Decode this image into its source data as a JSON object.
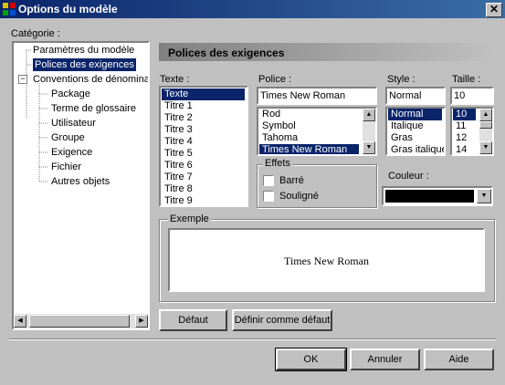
{
  "window": {
    "title": "Options du modèle",
    "close_symbol": "✕"
  },
  "category": {
    "label": "Catégorie :",
    "tree": [
      {
        "label": "Paramètres du modèle"
      },
      {
        "label": "Polices des exigences"
      },
      {
        "label": "Conventions de dénomination"
      },
      {
        "label": "Package"
      },
      {
        "label": "Terme de glossaire"
      },
      {
        "label": "Utilisateur"
      },
      {
        "label": "Groupe"
      },
      {
        "label": "Exigence"
      },
      {
        "label": "Fichier"
      },
      {
        "label": "Autres objets"
      }
    ],
    "expander": "−"
  },
  "panel": {
    "header": "Polices des exigences"
  },
  "texte": {
    "label": "Texte :",
    "items": [
      "Texte",
      "Titre 1",
      "Titre 2",
      "Titre 3",
      "Titre 4",
      "Titre 5",
      "Titre 6",
      "Titre 7",
      "Titre 8",
      "Titre 9"
    ],
    "selected": "Texte"
  },
  "police": {
    "label": "Police :",
    "value": "Times New Roman",
    "items": [
      "Rod",
      "Symbol",
      "Tahoma",
      "Times New Roman"
    ],
    "selected": "Times New Roman"
  },
  "style": {
    "label": "Style :",
    "value": "Normal",
    "items": [
      "Normal",
      "Italique",
      "Gras",
      "Gras italique"
    ],
    "selected": "Normal"
  },
  "taille": {
    "label": "Taille :",
    "value": "10",
    "items": [
      "10",
      "11",
      "12",
      "14"
    ],
    "selected": "10"
  },
  "effets": {
    "label": "Effets",
    "barre": "Barré",
    "souligne": "Souligné"
  },
  "couleur": {
    "label": "Couleur :",
    "value": "#000000"
  },
  "exemple": {
    "label": "Exemple",
    "text": "Times New Roman"
  },
  "buttons": {
    "defaut": "Défaut",
    "definir": "Définir comme défaut",
    "ok": "OK",
    "annuler": "Annuler",
    "aide": "Aide"
  },
  "colors": {
    "selection": "#0a246a",
    "title_start": "#0a246a",
    "title_end": "#3a6ea5"
  }
}
